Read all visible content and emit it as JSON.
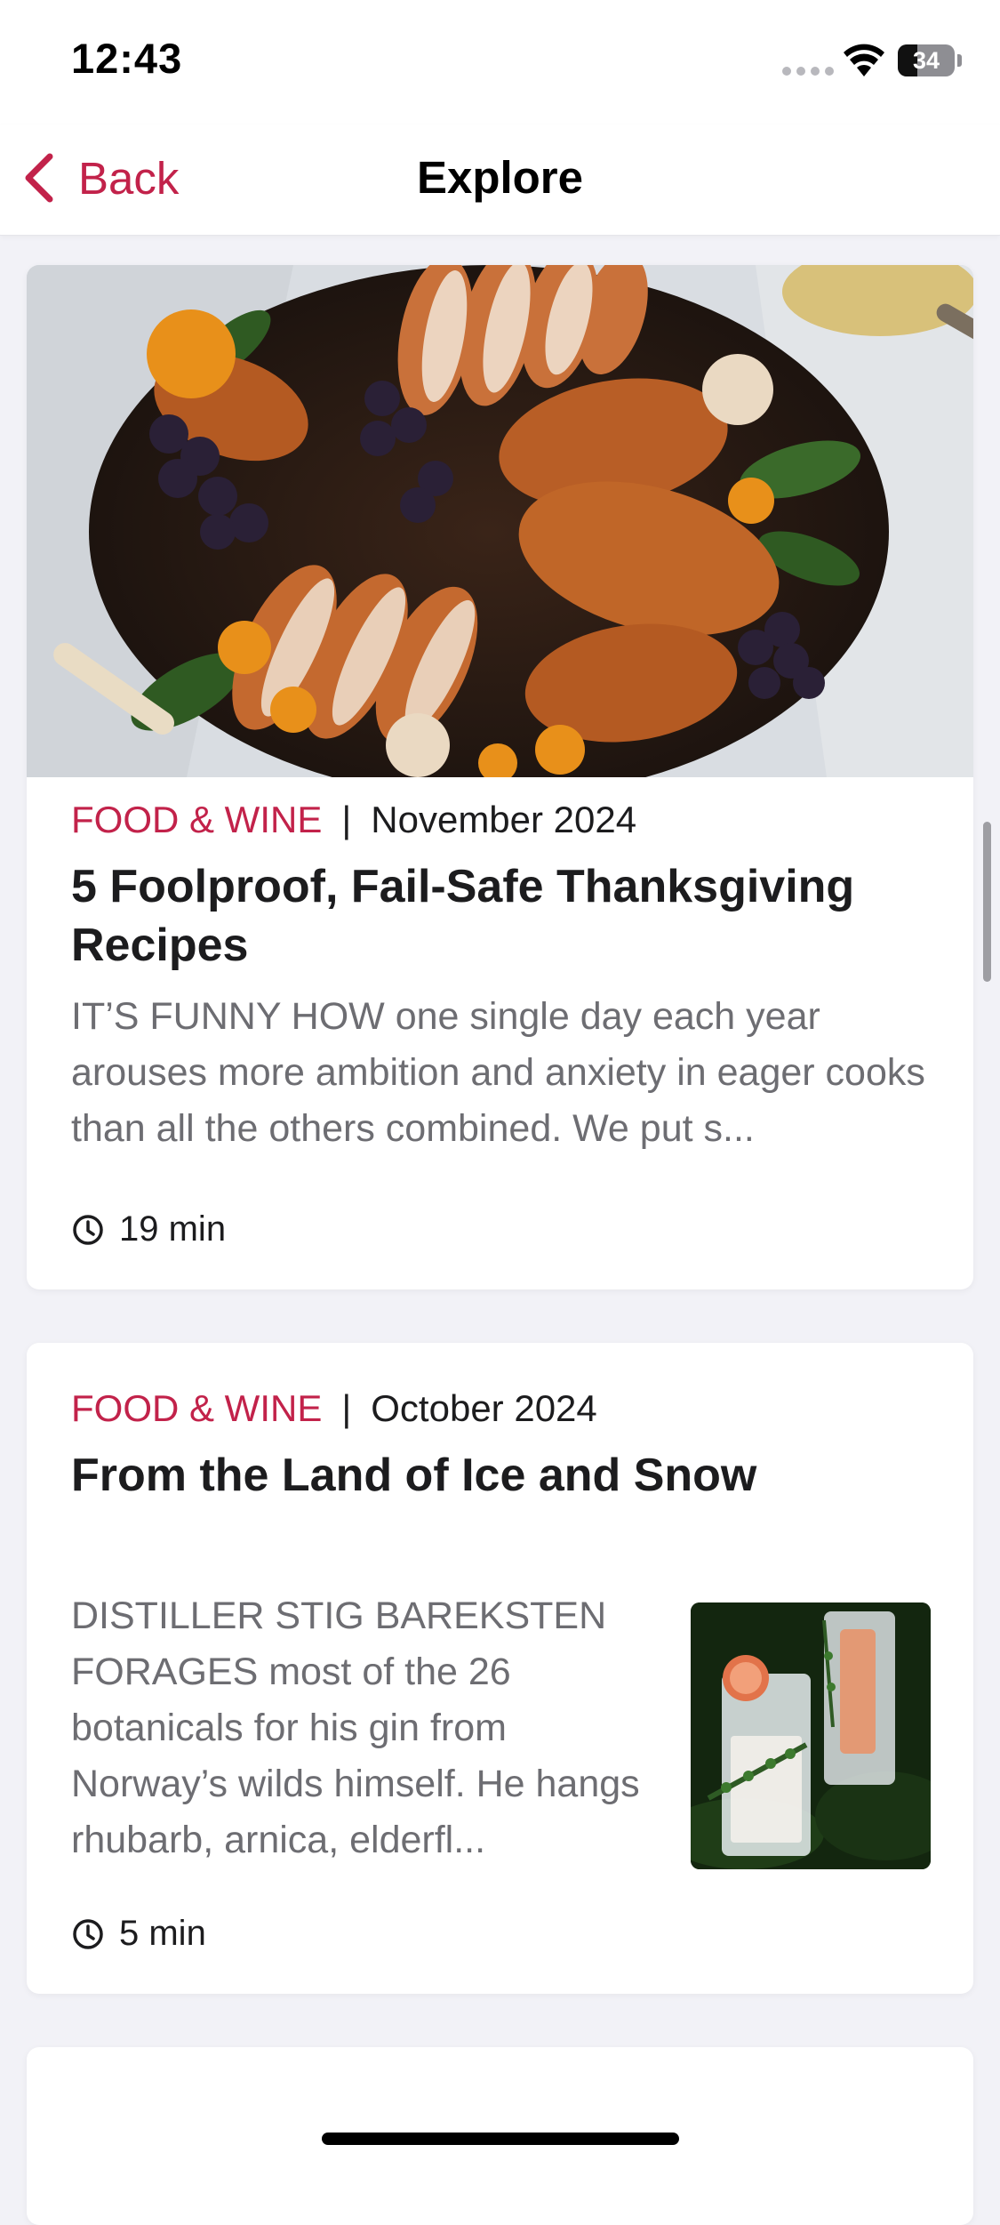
{
  "status_bar": {
    "time": "12:43",
    "battery": "34",
    "battery_level": 0.34
  },
  "nav": {
    "back_label": "Back",
    "title": "Explore"
  },
  "articles": [
    {
      "source": "FOOD & WINE",
      "separator": "|",
      "date": "November 2024",
      "title": "5 Foolproof, Fail-Safe Thanksgiving Recipes",
      "excerpt": "IT’S FUNNY HOW one single day each year arouses more ambition and anxiety in eager cooks than all the others combined. We put s...",
      "read_time": "19 min",
      "image_icon": "roast-turkey-platter-image"
    },
    {
      "source": "FOOD & WINE",
      "separator": "|",
      "date": "October 2024",
      "title": "From the Land of Ice and Snow",
      "excerpt": "DISTILLER STIG BAREKSTEN FORAGES most of the 26 botanicals for his gin from Norway’s wilds himself. He hangs rhubarb, arnica, elderfl...",
      "read_time": "5 min",
      "image_icon": "gin-cocktails-image"
    }
  ],
  "colors": {
    "accent": "#c2224a",
    "background": "#f2f2f7",
    "card": "#ffffff",
    "excerpt_text": "#6d6d72"
  }
}
